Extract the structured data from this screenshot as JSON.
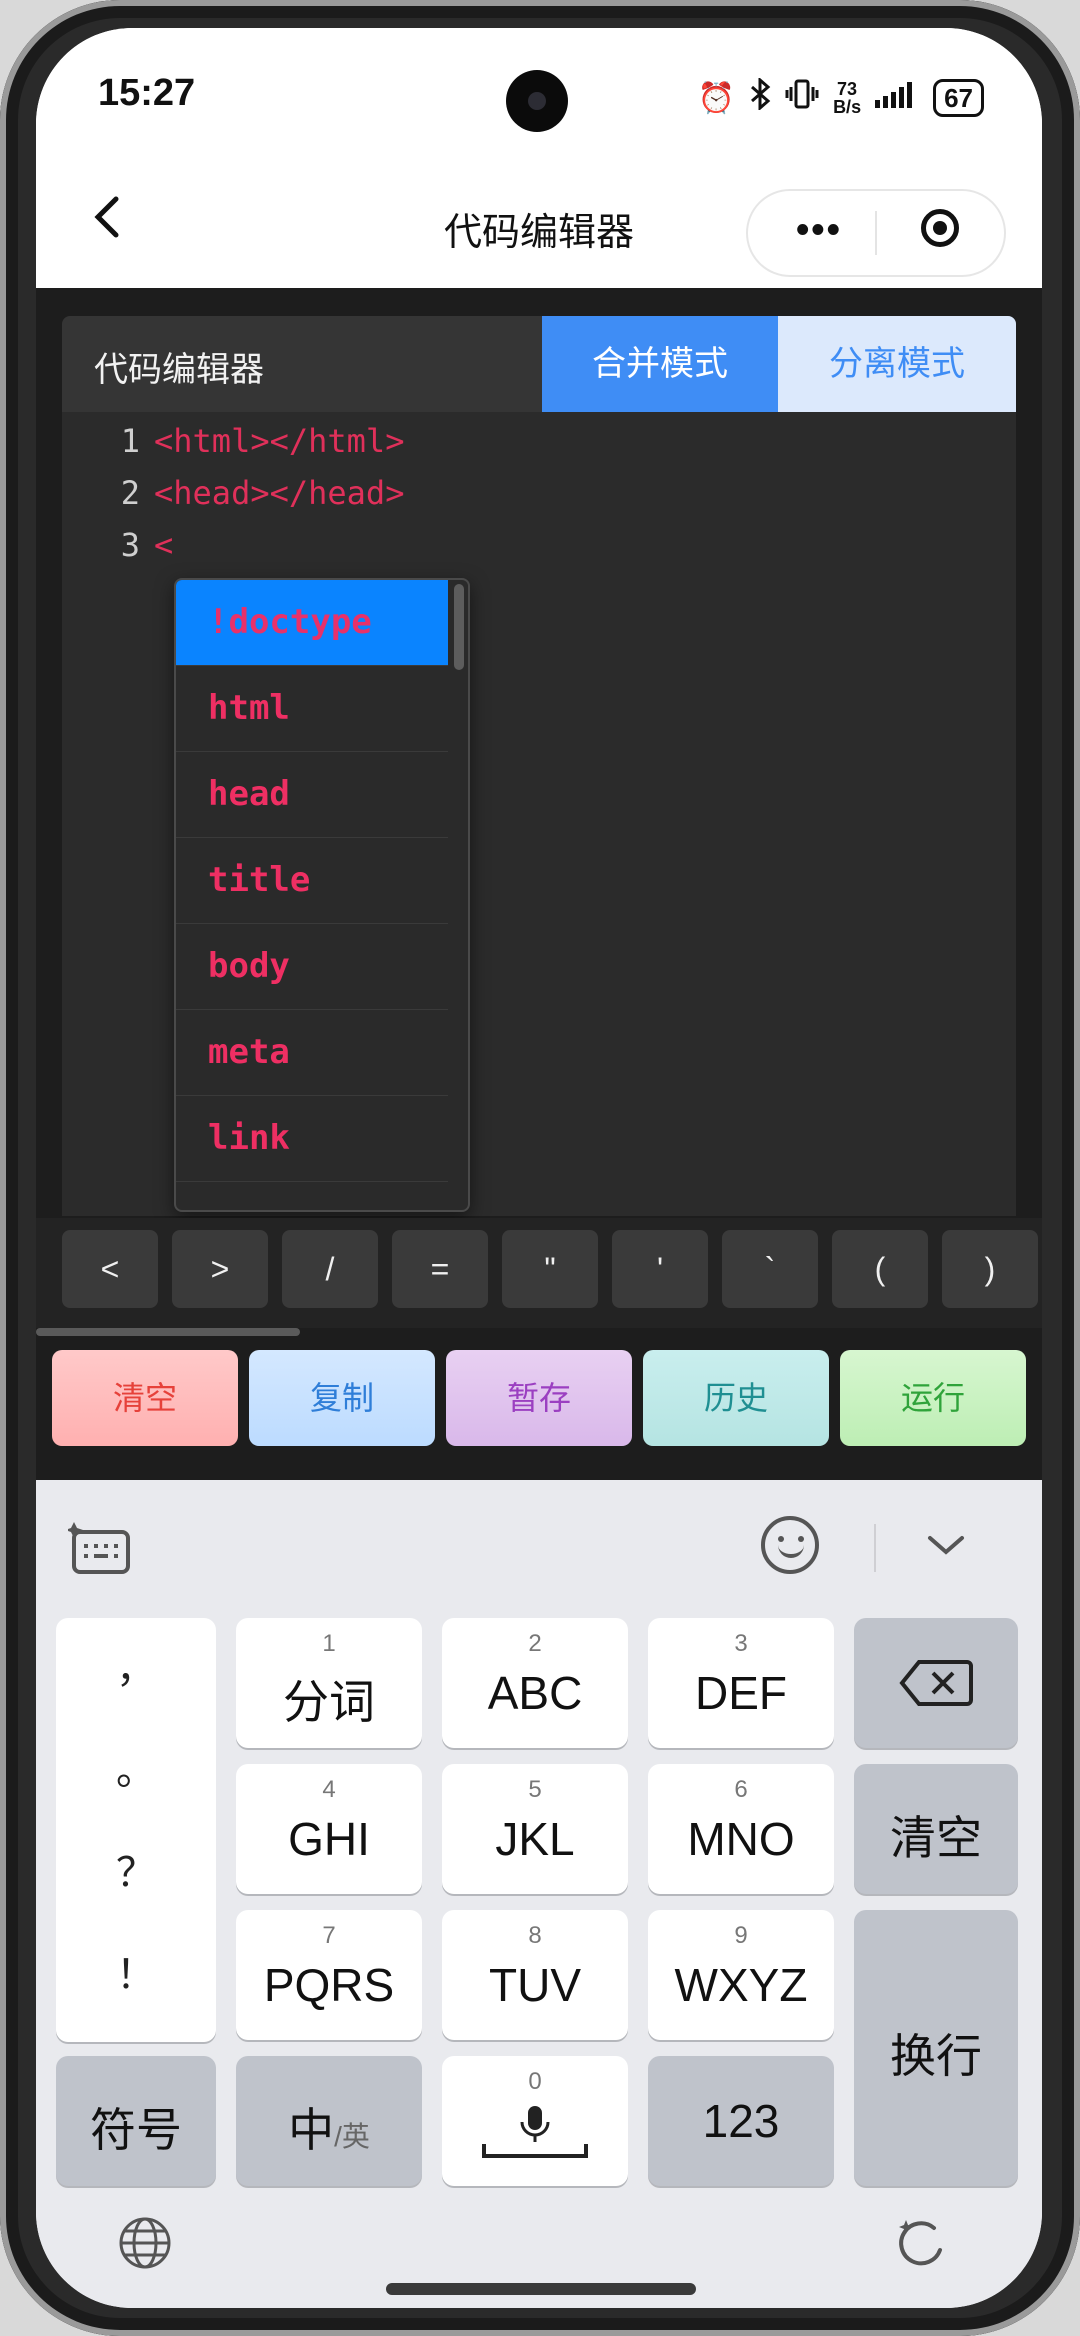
{
  "status_bar": {
    "time": "15:27",
    "net_speed_value": "73",
    "net_speed_unit": "B/s",
    "battery": "67",
    "icons": [
      "alarm-icon",
      "bluetooth-icon",
      "vibrate-icon",
      "signal-icon",
      "battery-icon"
    ]
  },
  "nav": {
    "title": "代码编辑器",
    "more_label": "•••"
  },
  "editor": {
    "title": "代码编辑器",
    "mode_merge": "合并模式",
    "mode_split": "分离模式",
    "lines": [
      {
        "num": "1",
        "code": "<html></html>"
      },
      {
        "num": "2",
        "code": "<head></head>"
      },
      {
        "num": "3",
        "code": "<"
      }
    ],
    "autocomplete": [
      "!doctype",
      "html",
      "head",
      "title",
      "body",
      "meta",
      "link"
    ],
    "selected_index": 0
  },
  "symbols": [
    "<",
    ">",
    "/",
    "=",
    "\"",
    "'",
    "`",
    "(",
    ")"
  ],
  "actions": {
    "clear": "清空",
    "copy": "复制",
    "save": "暂存",
    "history": "历史",
    "run": "运行"
  },
  "keyboard": {
    "punctuation": [
      "，",
      "。",
      "？",
      "！"
    ],
    "keys_row1": [
      {
        "num": "1",
        "label": "分词"
      },
      {
        "num": "2",
        "label": "ABC"
      },
      {
        "num": "3",
        "label": "DEF"
      }
    ],
    "keys_row2": [
      {
        "num": "4",
        "label": "GHI"
      },
      {
        "num": "5",
        "label": "JKL"
      },
      {
        "num": "6",
        "label": "MNO"
      }
    ],
    "keys_row3": [
      {
        "num": "7",
        "label": "PQRS"
      },
      {
        "num": "8",
        "label": "TUV"
      },
      {
        "num": "9",
        "label": "WXYZ"
      }
    ],
    "clear": "清空",
    "enter": "换行",
    "symbols": "符号",
    "lang_main": "中",
    "lang_alt": "/英",
    "space_num": "0",
    "num_mode": "123"
  }
}
